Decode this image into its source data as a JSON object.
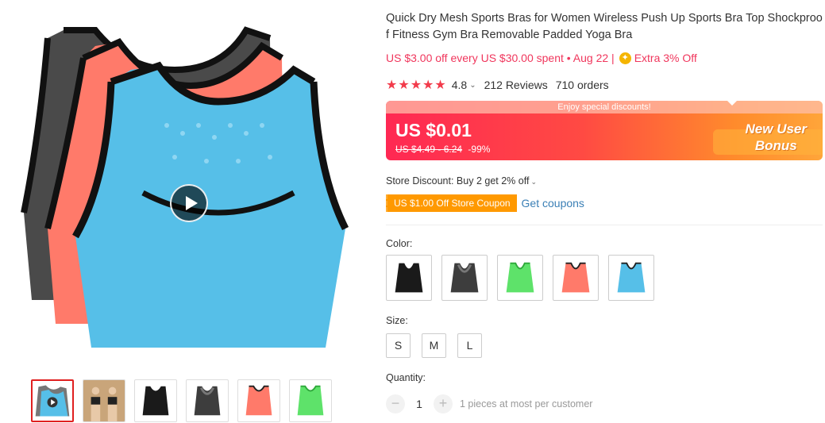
{
  "product": {
    "title": "Quick Dry Mesh Sports Bras for Women Wireless Push Up Sports Bra Top Shockproof Fitness Gym Bra Removable Padded Yoga Bra",
    "promo_text": "US $3.00 off every US $30.00 spent • Aug 22 |",
    "promo_extra": "Extra 3% Off",
    "rating": "4.8",
    "reviews": "212 Reviews",
    "orders": "710 orders",
    "stars": "★★★★★"
  },
  "price": {
    "banner_strip": "Enjoy special discounts!",
    "current": "US $0.01",
    "original": "US $4.49 - 6.24",
    "discount": "-99%",
    "bonus_line1": "New User",
    "bonus_line2": "Bonus"
  },
  "store": {
    "discount_text": "Store Discount: Buy 2 get 2% off",
    "coupon_tag": "US $1.00 Off Store Coupon",
    "get_coupons": "Get coupons"
  },
  "options": {
    "color_label": "Color:",
    "colors": [
      {
        "name": "black",
        "fill": "#1a1a1a",
        "trim": "#000000"
      },
      {
        "name": "gray",
        "fill": "#3d3d3d",
        "trim": "#000000"
      },
      {
        "name": "green",
        "fill": "#5ee26a",
        "trim": "#2ea83a"
      },
      {
        "name": "coral",
        "fill": "#ff7a6a",
        "trim": "#222222"
      },
      {
        "name": "blue",
        "fill": "#56bfe8",
        "trim": "#222222"
      }
    ],
    "size_label": "Size:",
    "sizes": [
      "S",
      "M",
      "L"
    ],
    "quantity_label": "Quantity:",
    "quantity": "1",
    "quantity_note": "1 pieces at most per customer",
    "minus": "−",
    "plus": "+"
  },
  "colors": {
    "accent_red": "#f0365c",
    "link_blue": "#3a7fb5",
    "coupon_orange": "#ff9900",
    "star_red": "#f23b4b"
  }
}
